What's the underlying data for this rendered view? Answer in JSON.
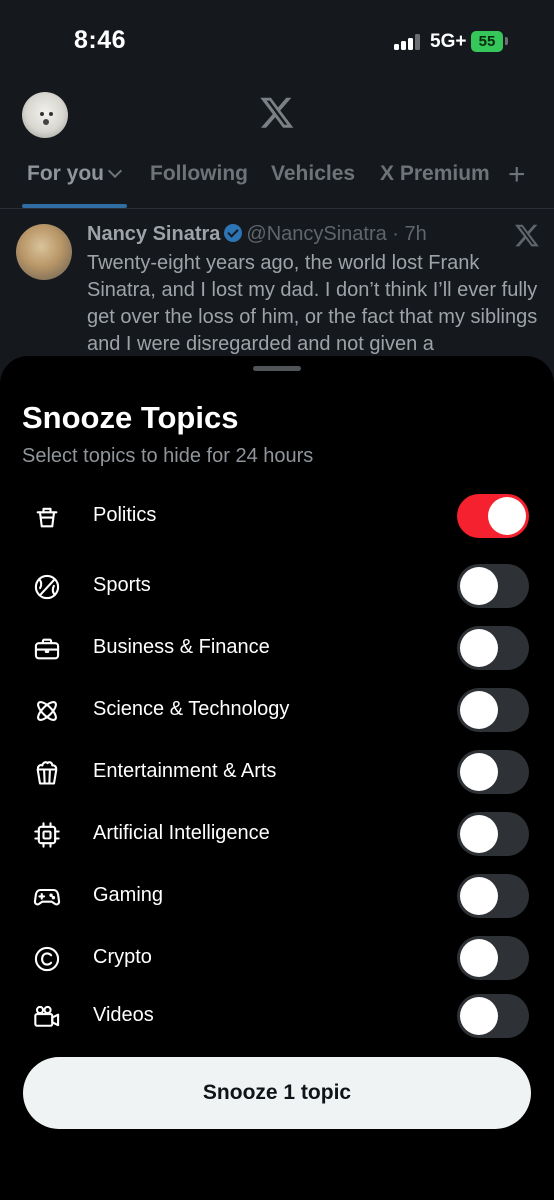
{
  "status": {
    "time": "8:46",
    "network": "5G+",
    "battery": "55"
  },
  "header": {
    "logo_icon": "x-logo-icon",
    "avatar": "avatar"
  },
  "tabs": [
    {
      "label": "For you"
    },
    {
      "label": "Following"
    },
    {
      "label": "Vehicles"
    },
    {
      "label": "X Premium"
    }
  ],
  "tweet": {
    "name": "Nancy Sinatra",
    "handle": "@NancySinatra · 7h",
    "text": "Twenty-eight years ago, the world lost Frank Sinatra, and I lost my dad. I don’t think I’ll ever fully get over the loss of him, or the fact that my siblings and I were disregarded and not given a"
  },
  "sheet": {
    "title": "Snooze Topics",
    "subtitle": "Select topics to hide for 24 hours",
    "topics": [
      {
        "label": "Politics",
        "icon": "podium-icon",
        "on": true
      },
      {
        "label": "Sports",
        "icon": "ball-icon",
        "on": false
      },
      {
        "label": "Business & Finance",
        "icon": "briefcase-icon",
        "on": false
      },
      {
        "label": "Science & Technology",
        "icon": "atom-icon",
        "on": false
      },
      {
        "label": "Entertainment & Arts",
        "icon": "popcorn-icon",
        "on": false
      },
      {
        "label": "Artificial Intelligence",
        "icon": "chip-icon",
        "on": false
      },
      {
        "label": "Gaming",
        "icon": "gamepad-icon",
        "on": false
      },
      {
        "label": "Crypto",
        "icon": "coin-icon",
        "on": false
      },
      {
        "label": "Videos",
        "icon": "video-camera-icon",
        "on": false
      }
    ],
    "button_label": "Snooze 1 topic"
  },
  "colors": {
    "toggle_on": "#f5212e",
    "toggle_off": "#2e3236",
    "button_bg": "#eff3f4"
  }
}
